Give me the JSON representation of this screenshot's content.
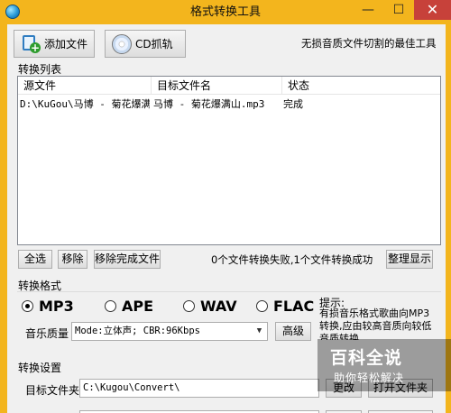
{
  "window": {
    "title": "格式转换工具",
    "controls": {
      "minimize": "—",
      "maximize": "☐",
      "close": "✕"
    }
  },
  "toolbar": {
    "add_file": "添加文件",
    "cd_rip": "CD抓轨",
    "slogan": "无损音质文件切割的最佳工具"
  },
  "list": {
    "section_title": "转换列表",
    "columns": [
      "源文件",
      "目标文件名",
      "状态"
    ],
    "rows": [
      {
        "source": "D:\\KuGou\\马博 - 菊花爆满...",
        "target": "马博 - 菊花爆满山.mp3",
        "status": "完成"
      }
    ]
  },
  "list_actions": {
    "select_all": "全选",
    "remove": "移除",
    "remove_done": "移除完成文件",
    "status": "0个文件转换失败,1个文件转换成功",
    "tidy": "整理显示"
  },
  "format": {
    "section_title": "转换格式",
    "options": [
      "MP3",
      "APE",
      "WAV",
      "FLAC"
    ],
    "selected": "MP3",
    "tip_title": "提示:",
    "tip_body": "有损音乐格式歌曲向MP3转换,应由较高音质向较低音质转换",
    "quality_label": "音乐质量",
    "quality_value": "Mode:立体声; CBR:96Kbps",
    "advanced": "高级"
  },
  "settings": {
    "section_title": "转换设置",
    "dest_label": "目标文件夹",
    "dest_value": "C:\\Kugou\\Convert\\",
    "browse": "更改",
    "open_folder": "打开文件夹"
  },
  "watermark": {
    "big": "百科全说",
    "small": "助你轻松解决"
  }
}
